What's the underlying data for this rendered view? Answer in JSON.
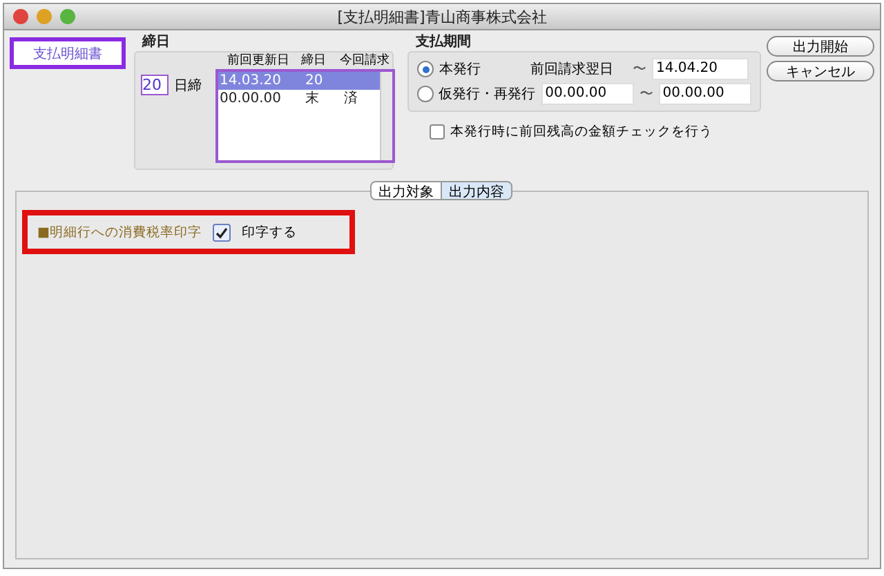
{
  "window": {
    "title": "[支払明細書]青山商事株式会社"
  },
  "doc_type_button": {
    "label": "支払明細書",
    "selected": true
  },
  "closing": {
    "title": "締日",
    "day": "20",
    "day_label": "日締",
    "columns": [
      "前回更新日",
      "締日",
      "今回請求"
    ],
    "rows": [
      {
        "cells": [
          "14.03.20",
          "20",
          ""
        ],
        "selected": true
      },
      {
        "cells": [
          "00.00.00",
          "末",
          "済"
        ],
        "selected": false
      }
    ]
  },
  "period": {
    "title": "支払期間",
    "options": [
      {
        "label": "本発行",
        "selected": true,
        "from": "前回請求翌日",
        "to": "14.04.20",
        "kind": "text"
      },
      {
        "label": "仮発行・再発行",
        "selected": false,
        "from": "00.00.00",
        "to": "00.00.00",
        "kind": "field"
      }
    ],
    "separator": "〜"
  },
  "balance_check": {
    "label": "本発行時に前回残高の金額チェックを行う",
    "checked": false
  },
  "buttons": [
    "出力開始",
    "キャンセル"
  ],
  "tabs": [
    {
      "label": "出力対象",
      "selected": false
    },
    {
      "label": "出力内容",
      "selected": true
    }
  ],
  "option": {
    "label": "■明細行への消費税率印字",
    "checkbox": {
      "label": "印字する",
      "checked": true
    },
    "highlighted": true
  }
}
